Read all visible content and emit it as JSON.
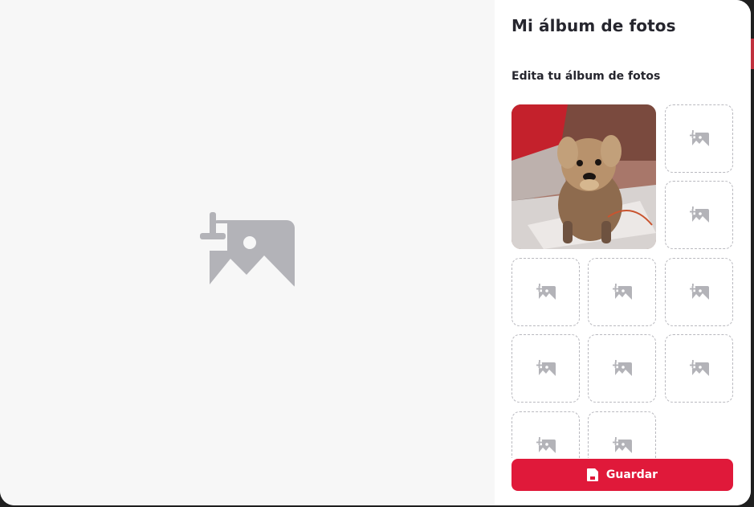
{
  "modal": {
    "title": "Mi álbum de fotos",
    "subtitle": "Edita tu álbum de fotos"
  },
  "preview": {
    "icon": "add-image-icon"
  },
  "album": {
    "photo_description": "perrito yorkshire sobre una manta",
    "empty_slot_icon": "add-image-icon",
    "slot_count": 11
  },
  "actions": {
    "save_label": "Guardar",
    "save_icon": "save-icon"
  },
  "colors": {
    "accent": "#e0193a",
    "icon_gray": "#b3b3b8",
    "title": "#26262e"
  }
}
